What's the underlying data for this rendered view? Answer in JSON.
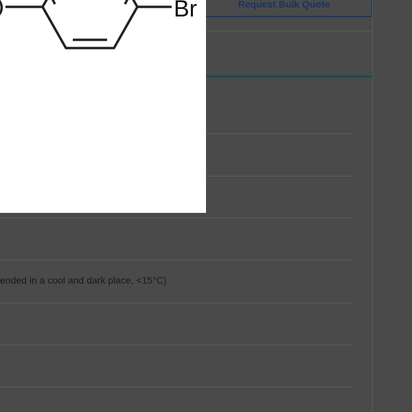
{
  "header": {
    "bulk_quote_label": "Request Bulk Quote"
  },
  "structure": {
    "atom_label": "Br"
  },
  "properties": {
    "storage_text": "ended in a cool and dark place, <15°C)"
  },
  "colors": {
    "overlay": "#4a4a4a",
    "button_border": "#163a6b",
    "tab_accent": "#0f5150"
  }
}
